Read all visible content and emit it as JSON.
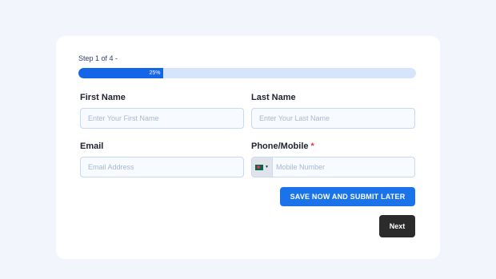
{
  "form": {
    "step_text": "Step 1 of 4 -",
    "progress": {
      "value": 0.25,
      "label": "25%"
    },
    "colors": {
      "accent": "#1a73e8",
      "progress_track": "#d6e5fb",
      "next_button": "#2b2b2b",
      "required": "#e53935"
    },
    "fields": {
      "first_name": {
        "label": "First Name",
        "placeholder": "Enter Your First Name",
        "value": ""
      },
      "last_name": {
        "label": "Last Name",
        "placeholder": "Enter Your Last Name",
        "value": ""
      },
      "email": {
        "label": "Email",
        "placeholder": "Email Address",
        "value": ""
      },
      "phone": {
        "label": "Phone/Mobile",
        "required_mark": "*",
        "placeholder": "Mobile Number",
        "value": "",
        "country_flag_icon": "bangladesh-flag-icon"
      }
    },
    "buttons": {
      "save_later": "SAVE NOW AND SUBMIT LATER",
      "next": "Next"
    }
  }
}
